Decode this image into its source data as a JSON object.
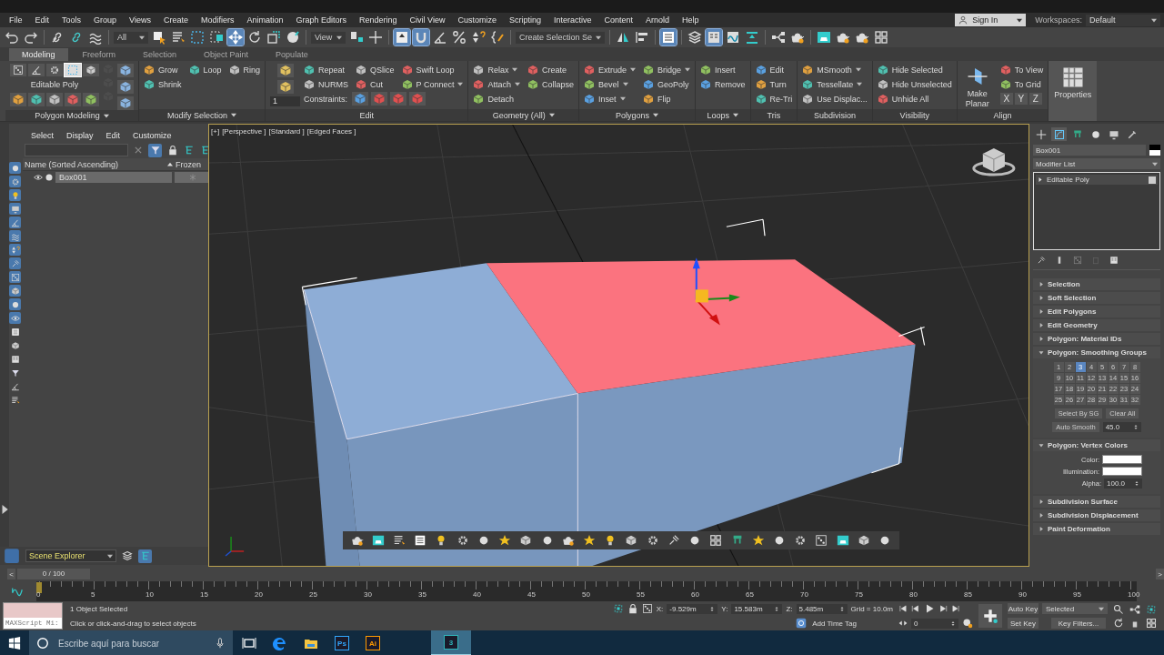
{
  "menu": [
    "File",
    "Edit",
    "Tools",
    "Group",
    "Views",
    "Create",
    "Modifiers",
    "Animation",
    "Graph Editors",
    "Rendering",
    "Civil View",
    "Customize",
    "Scripting",
    "Interactive",
    "Content",
    "Arnold",
    "Help"
  ],
  "account": {
    "sign_in": "Sign In",
    "workspaces_label": "Workspaces:",
    "workspace": "Default"
  },
  "toolbar": [
    {
      "kind": "button",
      "on": false
    },
    {
      "kind": "button",
      "on": false
    },
    {
      "kind": "button",
      "on": false
    },
    {
      "kind": "button",
      "on": false
    },
    {
      "kind": "button",
      "on": false
    },
    {
      "kind": "dropdown",
      "value": "All"
    },
    {
      "kind": "button",
      "on": false
    },
    {
      "kind": "button",
      "on": false
    },
    {
      "kind": "button",
      "on": false
    },
    {
      "kind": "button",
      "on": false
    },
    {
      "kind": "button",
      "on": true
    },
    {
      "kind": "button",
      "on": false
    },
    {
      "kind": "button",
      "on": false
    },
    {
      "kind": "button",
      "on": false
    },
    {
      "kind": "dropdown",
      "value": "View"
    },
    {
      "kind": "button",
      "on": false
    },
    {
      "kind": "button",
      "on": false
    },
    {
      "kind": "button",
      "on": true
    },
    {
      "kind": "button",
      "on": true
    },
    {
      "kind": "button",
      "on": false
    },
    {
      "kind": "button",
      "on": false
    },
    {
      "kind": "button",
      "on": false
    },
    {
      "kind": "button",
      "on": false
    },
    {
      "kind": "dropdown",
      "value": "Create Selection Se"
    },
    {
      "kind": "button",
      "on": false
    },
    {
      "kind": "button",
      "on": false
    },
    {
      "kind": "button",
      "on": true
    },
    {
      "kind": "button",
      "on": false
    },
    {
      "kind": "button",
      "on": true
    },
    {
      "kind": "button",
      "on": false
    },
    {
      "kind": "button",
      "on": false
    },
    {
      "kind": "button",
      "on": false
    },
    {
      "kind": "button",
      "on": false
    },
    {
      "kind": "button",
      "on": false
    },
    {
      "kind": "button",
      "on": false
    },
    {
      "kind": "button",
      "on": false
    },
    {
      "kind": "button",
      "on": false
    }
  ],
  "ribbon": {
    "tabs": [
      {
        "label": "Modeling",
        "selected": true
      },
      {
        "label": "Freeform",
        "selected": false
      },
      {
        "label": "Selection",
        "selected": false
      },
      {
        "label": "Object Paint",
        "selected": false
      },
      {
        "label": "Populate",
        "selected": false
      }
    ],
    "panels": [
      {
        "kind": "polymodel",
        "title": "Polygon Modeling",
        "menu": true,
        "label": "Editable Poly",
        "levels": [
          {
            "selected": false
          },
          {
            "selected": false
          },
          {
            "selected": false
          },
          {
            "selected": true
          },
          {
            "selected": false
          }
        ]
      },
      {
        "kind": "tools",
        "title": "Modify Selection",
        "menu": true,
        "columns": [
          [
            {
              "label": "Grow"
            },
            {
              "label": "Shrink"
            }
          ],
          [
            {
              "label": "Loop"
            }
          ],
          [
            {
              "label": "Ring"
            }
          ]
        ]
      },
      {
        "kind": "edit",
        "title": "Edit",
        "menu": false,
        "spinner": "1",
        "constraints": "Constraints:",
        "columns": [
          [
            {
              "label": "Repeat"
            },
            {
              "label": "NURMS"
            }
          ],
          [
            {
              "label": "QSlice"
            },
            {
              "label": "Cut"
            }
          ],
          [
            {
              "label": "Swift Loop"
            },
            {
              "label": "P Connect",
              "dropdown": true
            }
          ]
        ]
      },
      {
        "kind": "tools",
        "title": "Geometry (All)",
        "menu": true,
        "columns": [
          [
            {
              "label": "Relax",
              "dropdown": true
            },
            {
              "label": "Attach",
              "dropdown": true
            },
            {
              "label": "Detach"
            }
          ],
          [
            {
              "label": "Create"
            },
            {
              "label": "Collapse"
            }
          ]
        ]
      },
      {
        "kind": "tools",
        "title": "Polygons",
        "menu": true,
        "columns": [
          [
            {
              "label": "Extrude",
              "dropdown": true
            },
            {
              "label": "Bevel",
              "dropdown": true
            },
            {
              "label": "Inset",
              "dropdown": true
            }
          ],
          [
            {
              "label": "Bridge",
              "dropdown": true
            },
            {
              "label": "GeoPoly"
            },
            {
              "label": "Flip"
            }
          ]
        ]
      },
      {
        "kind": "tools",
        "title": "Loops",
        "menu": true,
        "columns": [
          [
            {
              "label": "Insert"
            },
            {
              "label": "Remove"
            }
          ]
        ]
      },
      {
        "kind": "tools",
        "title": "Tris",
        "menu": false,
        "columns": [
          [
            {
              "label": "Edit"
            },
            {
              "label": "Turn"
            },
            {
              "label": "Re-Tri"
            }
          ]
        ]
      },
      {
        "kind": "tools",
        "title": "Subdivision",
        "menu": false,
        "columns": [
          [
            {
              "label": "MSmooth",
              "dropdown": true
            },
            {
              "label": "Tessellate",
              "dropdown": true
            },
            {
              "label": "Use Displac..."
            }
          ]
        ]
      },
      {
        "kind": "tools",
        "title": "Visibility",
        "menu": false,
        "columns": [
          [
            {
              "label": "Hide Selected"
            },
            {
              "label": "Hide Unselected"
            },
            {
              "label": "Unhide All"
            }
          ]
        ]
      },
      {
        "kind": "tools",
        "title": "Align",
        "menu": false,
        "columns": [
          [
            {
              "label": "Make Planar",
              "kind": "big"
            }
          ],
          [
            {
              "label": "To View"
            },
            {
              "label": "To Grid"
            },
            {
              "kind": "axes",
              "axes": [
                "X",
                "Y",
                "Z"
              ]
            }
          ]
        ]
      },
      {
        "kind": "properties",
        "label": "Properties"
      }
    ]
  },
  "scene_explorer": {
    "filters": [
      {
        "on": true
      },
      {
        "on": true
      },
      {
        "on": true
      },
      {
        "on": true
      },
      {
        "on": true
      },
      {
        "on": true
      },
      {
        "on": true
      },
      {
        "on": true
      },
      {
        "on": true
      },
      {
        "on": true
      },
      {
        "on": true
      },
      {
        "on": true
      },
      {
        "on": false
      },
      {
        "on": false
      },
      {
        "on": false
      },
      {
        "on": false
      },
      {
        "on": false
      },
      {
        "on": false
      }
    ],
    "menu": [
      "Select",
      "Display",
      "Edit",
      "Customize"
    ],
    "columns": [
      "Name (Sorted Ascending)",
      "Frozen"
    ],
    "rows": [
      {
        "name": "Box001",
        "selected": true
      }
    ],
    "footer": "Scene Explorer"
  },
  "viewport": {
    "labels": [
      "[+]",
      "[Perspective ]",
      "[Standard ]",
      "[Edged Faces ]"
    ]
  },
  "command_panel": {
    "tabs": [
      {
        "selected": false
      },
      {
        "selected": true
      },
      {
        "selected": false
      },
      {
        "selected": false
      },
      {
        "selected": false
      },
      {
        "selected": false
      }
    ],
    "object_name": "Box001",
    "modifier_list": "Modifier List",
    "stack": [
      {
        "label": "Editable Poly"
      }
    ],
    "rollouts": [
      {
        "title": "Selection",
        "expanded": false
      },
      {
        "title": "Soft Selection",
        "expanded": false
      },
      {
        "title": "Edit Polygons",
        "expanded": false
      },
      {
        "title": "Edit Geometry",
        "expanded": false
      },
      {
        "title": "Polygon: Material IDs",
        "expanded": false
      },
      {
        "title": "Polygon: Smoothing Groups",
        "expanded": true,
        "kind": "smoothing",
        "groups": [
          {
            "label": "1",
            "selected": false
          },
          {
            "label": "2",
            "selected": false
          },
          {
            "label": "3",
            "selected": true
          },
          {
            "label": "4",
            "selected": false
          },
          {
            "label": "5",
            "selected": false
          },
          {
            "label": "6",
            "selected": false
          },
          {
            "label": "7",
            "selected": false
          },
          {
            "label": "8",
            "selected": false
          },
          {
            "label": "9",
            "selected": false
          },
          {
            "label": "10",
            "selected": false
          },
          {
            "label": "11",
            "selected": false
          },
          {
            "label": "12",
            "selected": false
          },
          {
            "label": "13",
            "selected": false
          },
          {
            "label": "14",
            "selected": false
          },
          {
            "label": "15",
            "selected": false
          },
          {
            "label": "16",
            "selected": false
          },
          {
            "label": "17",
            "selected": false
          },
          {
            "label": "18",
            "selected": false
          },
          {
            "label": "19",
            "selected": false
          },
          {
            "label": "20",
            "selected": false
          },
          {
            "label": "21",
            "selected": false
          },
          {
            "label": "22",
            "selected": false
          },
          {
            "label": "23",
            "selected": false
          },
          {
            "label": "24",
            "selected": false
          },
          {
            "label": "25",
            "selected": false
          },
          {
            "label": "26",
            "selected": false
          },
          {
            "label": "27",
            "selected": false
          },
          {
            "label": "28",
            "selected": false
          },
          {
            "label": "29",
            "selected": false
          },
          {
            "label": "30",
            "selected": false
          },
          {
            "label": "31",
            "selected": false
          },
          {
            "label": "32",
            "selected": false
          }
        ],
        "buttons": [
          "Select By SG",
          "Clear All"
        ],
        "auto_smooth": "Auto Smooth",
        "threshold": "45.0"
      },
      {
        "title": "Polygon: Vertex Colors",
        "expanded": true,
        "kind": "vertex_colors",
        "swatches": [
          {
            "label": "Color:",
            "color": "#ffffff"
          },
          {
            "label": "Illumination:",
            "color": "#ffffff"
          }
        ],
        "alpha_label": "Alpha:",
        "alpha": "100.0"
      },
      {
        "title": "Subdivision Surface",
        "expanded": false
      },
      {
        "title": "Subdivision Displacement",
        "expanded": false
      },
      {
        "title": "Paint Deformation",
        "expanded": false
      }
    ]
  },
  "time_slider": {
    "prev": "<",
    "position": "0 / 100",
    "next": ">"
  },
  "track_bar": {
    "ticks": [
      "0",
      "5",
      "10",
      "15",
      "20",
      "25",
      "30",
      "35",
      "40",
      "45",
      "50",
      "55",
      "60",
      "65",
      "70",
      "75",
      "80",
      "85",
      "90",
      "95",
      "100"
    ]
  },
  "status": {
    "listener": "MAXScript Mi:",
    "selection": "1 Object Selected",
    "prompt": "Click or click-and-drag to select objects",
    "coords": [
      {
        "axis": "X:",
        "value": "-9.529m"
      },
      {
        "axis": "Y:",
        "value": "15.583m"
      },
      {
        "axis": "Z:",
        "value": "5.485m"
      }
    ],
    "grid": "Grid = 10.0m",
    "time_tag": "Add Time Tag",
    "frame": "0",
    "auto_key": "Auto Key",
    "set_key": "Set Key",
    "key_mode": "Selected",
    "key_filters": "Key Filters..."
  },
  "taskbar": {
    "search_placeholder": "Escribe aquí para buscar",
    "apps": [
      {
        "kind": "task_view",
        "active": false
      },
      {
        "kind": "edge",
        "active": false
      },
      {
        "kind": "folder",
        "active": false
      },
      {
        "kind": "app",
        "label": "Ps",
        "color": "#31a8ff",
        "active": false
      },
      {
        "kind": "app",
        "label": "Ai",
        "color": "#ff9a00",
        "active": false
      },
      {
        "kind": "app",
        "label": "3",
        "color": "#2fb3b8",
        "active": true
      }
    ]
  }
}
